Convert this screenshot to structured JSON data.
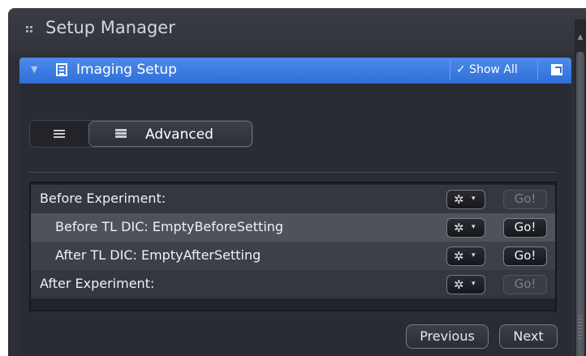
{
  "window": {
    "title": "Setup Manager"
  },
  "panel": {
    "title": "Imaging Setup",
    "show_all_label": "✓ Show All"
  },
  "mode": {
    "active": "Advanced",
    "advanced_label": "Advanced"
  },
  "rows": [
    {
      "label": "Before Experiment:",
      "indent": false,
      "go_enabled": false
    },
    {
      "label": "Before TL DIC:  EmptyBeforeSetting",
      "indent": true,
      "go_enabled": true,
      "selected": true
    },
    {
      "label": "After TL DIC:  EmptyAfterSetting",
      "indent": true,
      "go_enabled": true
    },
    {
      "label": "After Experiment:",
      "indent": false,
      "go_enabled": false
    }
  ],
  "row_buttons": {
    "go_label": "Go!",
    "gear_icon": "gear-icon",
    "caret": "▾"
  },
  "footer": {
    "previous_label": "Previous",
    "next_label": "Next"
  }
}
